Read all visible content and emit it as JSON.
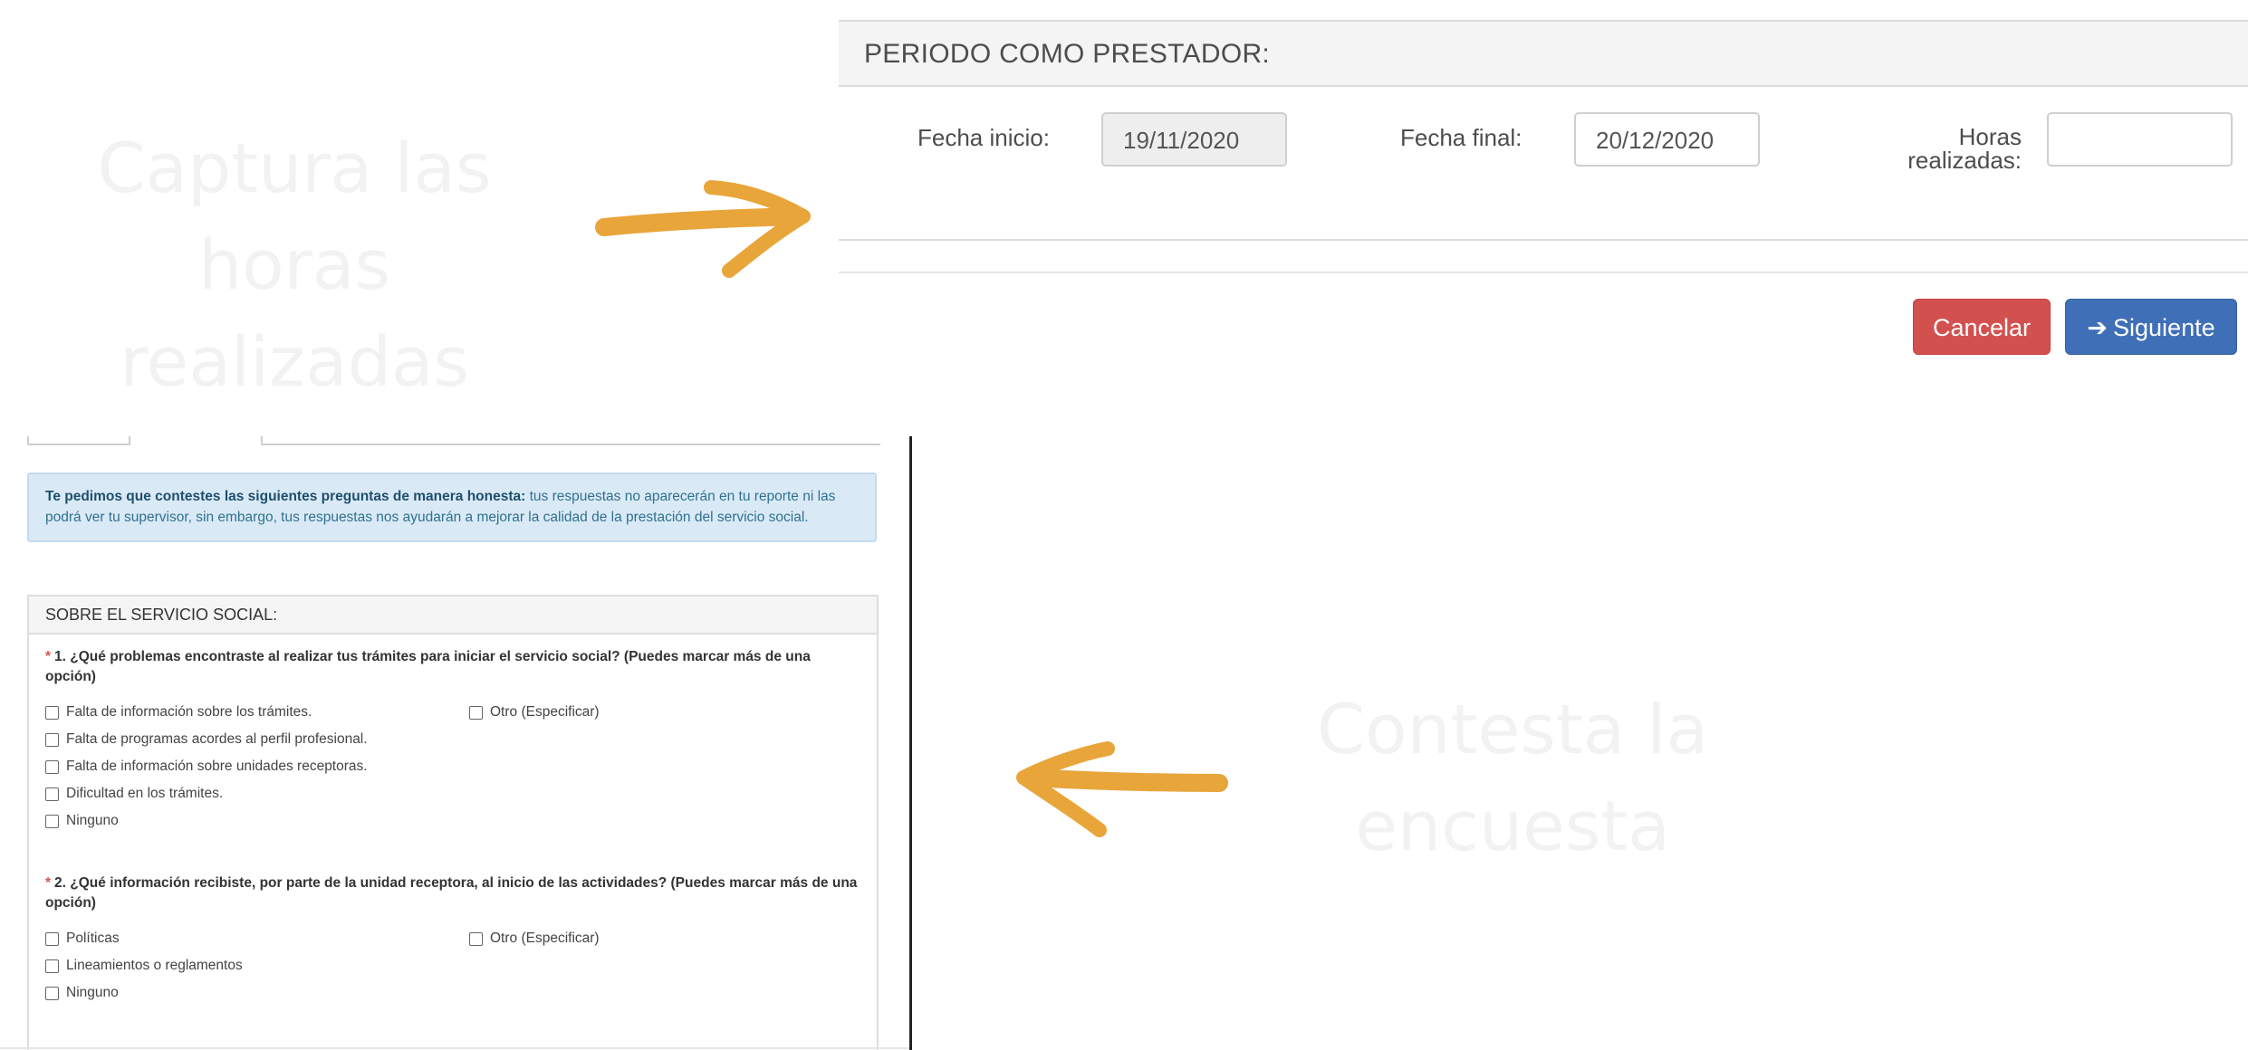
{
  "captions": {
    "top": [
      "Captura las horas",
      "realizadas"
    ],
    "bottom": [
      "Contesta la",
      "encuesta"
    ]
  },
  "colors": {
    "arrow": "#e8a53a",
    "cancel": "#d2514f",
    "next": "#3f6fb7",
    "info": "#d9eaf6"
  },
  "period": {
    "heading": "PERIODO COMO PRESTADOR:",
    "start_label": "Fecha inicio:",
    "start_value": "19/11/2020",
    "end_label": "Fecha final:",
    "end_value": "20/12/2020",
    "hours_label_line1": "Horas",
    "hours_label_line2": "realizadas:",
    "hours_value": ""
  },
  "buttons": {
    "cancel": "Cancelar",
    "next": "Siguiente",
    "next_icon": "arrow-right-icon"
  },
  "survey": {
    "intro_bold": "Te pedimos que contestes las siguientes preguntas de manera honesta:",
    "intro_text": " tus respuestas no aparecerán en tu reporte ni las podrá ver tu supervisor, sin embargo, tus respuestas nos ayudarán a mejorar la calidad de la prestación del servicio social.",
    "section_title": "SOBRE EL SERVICIO SOCIAL:",
    "q1": {
      "text": "1. ¿Qué problemas encontraste al realizar tus trámites para iniciar el servicio social? (Puedes marcar más de una opción)",
      "options": [
        "Falta de información sobre los trámites.",
        "Falta de programas acordes al perfil profesional.",
        "Falta de información sobre unidades receptoras.",
        "Dificultad en los trámites.",
        "Ninguno"
      ],
      "other": "Otro (Especificar)"
    },
    "q2": {
      "text": "2. ¿Qué información recibiste, por parte de la unidad receptora, al inicio de las actividades? (Puedes marcar más de una opción)",
      "options": [
        "Políticas",
        "Lineamientos o reglamentos",
        "Ninguno"
      ],
      "other": "Otro (Especificar)"
    },
    "required_mark": "*"
  }
}
